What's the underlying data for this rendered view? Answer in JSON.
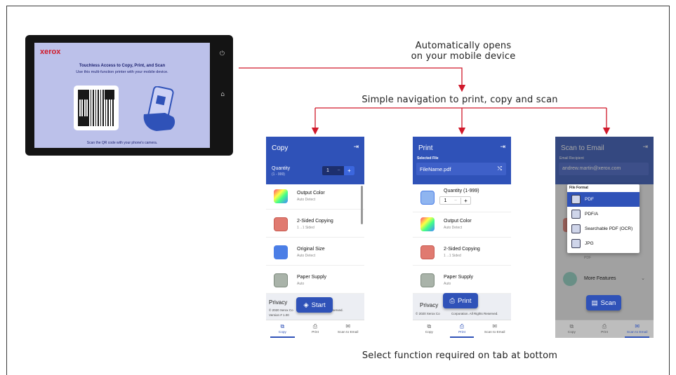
{
  "captions": {
    "auto_opens_line1": "Automatically opens",
    "auto_opens_line2": "on your mobile device",
    "simple_nav": "Simple navigation to print, copy and scan",
    "select_function": "Select function required on tab at bottom"
  },
  "tablet": {
    "logo": "xerox",
    "heading": "Touchless Access to Copy, Print, and Scan",
    "subheading": "Use this multi-function printer with your mobile device.",
    "footer": "Scan the QR code with your phone's camera.",
    "icons": [
      "power-icon",
      "home-icon"
    ]
  },
  "phones": {
    "copy": {
      "title": "Copy",
      "quantity_label": "Quantity",
      "quantity_range": "(1 - 999)",
      "quantity_value": "1",
      "minus": "−",
      "plus": "+",
      "rows": [
        {
          "label": "Output Color",
          "sub": "Auto Detect"
        },
        {
          "label": "2-Sided Copying",
          "sub": "1→1 Sided"
        },
        {
          "label": "Original Size",
          "sub": "Auto Detect"
        },
        {
          "label": "Paper Supply",
          "sub": "Auto"
        }
      ],
      "privacy": "Privacy",
      "copyright": "© 2020 Xerox Co",
      "copyright_tail": "served.",
      "version": "Version # 1.00",
      "fab": "Start",
      "tabs": [
        "Copy",
        "Print",
        "Scan to Email"
      ],
      "active_tab": "Copy"
    },
    "print": {
      "title": "Print",
      "selected_file_label": "Selected File",
      "file_name": "FileName.pdf",
      "quantity_label": "Quantity (1-999)",
      "quantity_value": "1",
      "minus": "−",
      "plus": "+",
      "rows": [
        {
          "label": "Output Color",
          "sub": "Auto Detect"
        },
        {
          "label": "2-Sided Copying",
          "sub": "1→1 Sided"
        },
        {
          "label": "Paper Supply",
          "sub": "Auto"
        }
      ],
      "privacy": "Privacy",
      "copyright": "© 2020 Xerox Co",
      "copyright_tail": "Corporation. All Rights Reserved.",
      "fab": "Print",
      "tabs": [
        "Copy",
        "Print",
        "Scan to Email"
      ],
      "active_tab": "Print"
    },
    "scan": {
      "title": "Scan to Email",
      "recipient_label": "Email Recipient",
      "recipient_value": "andrew.martin@xerox.com",
      "file_format_label": "File Format",
      "formats": [
        "PDF",
        "PDF/A",
        "Searchable PDF (OCR)",
        "JPG"
      ],
      "selected_format": "PDF",
      "behind_row_sub": "PDF",
      "more_features": "More Features",
      "fab": "Scan",
      "tabs": [
        "Copy",
        "Print",
        "Scan to Email"
      ],
      "active_tab": "Scan to Email"
    }
  },
  "colors": {
    "brand_blue": "#2f52b8",
    "arrow_red": "#d0192b",
    "xerox_red": "#d11a2a",
    "tablet_screen": "#bcc1ea"
  }
}
